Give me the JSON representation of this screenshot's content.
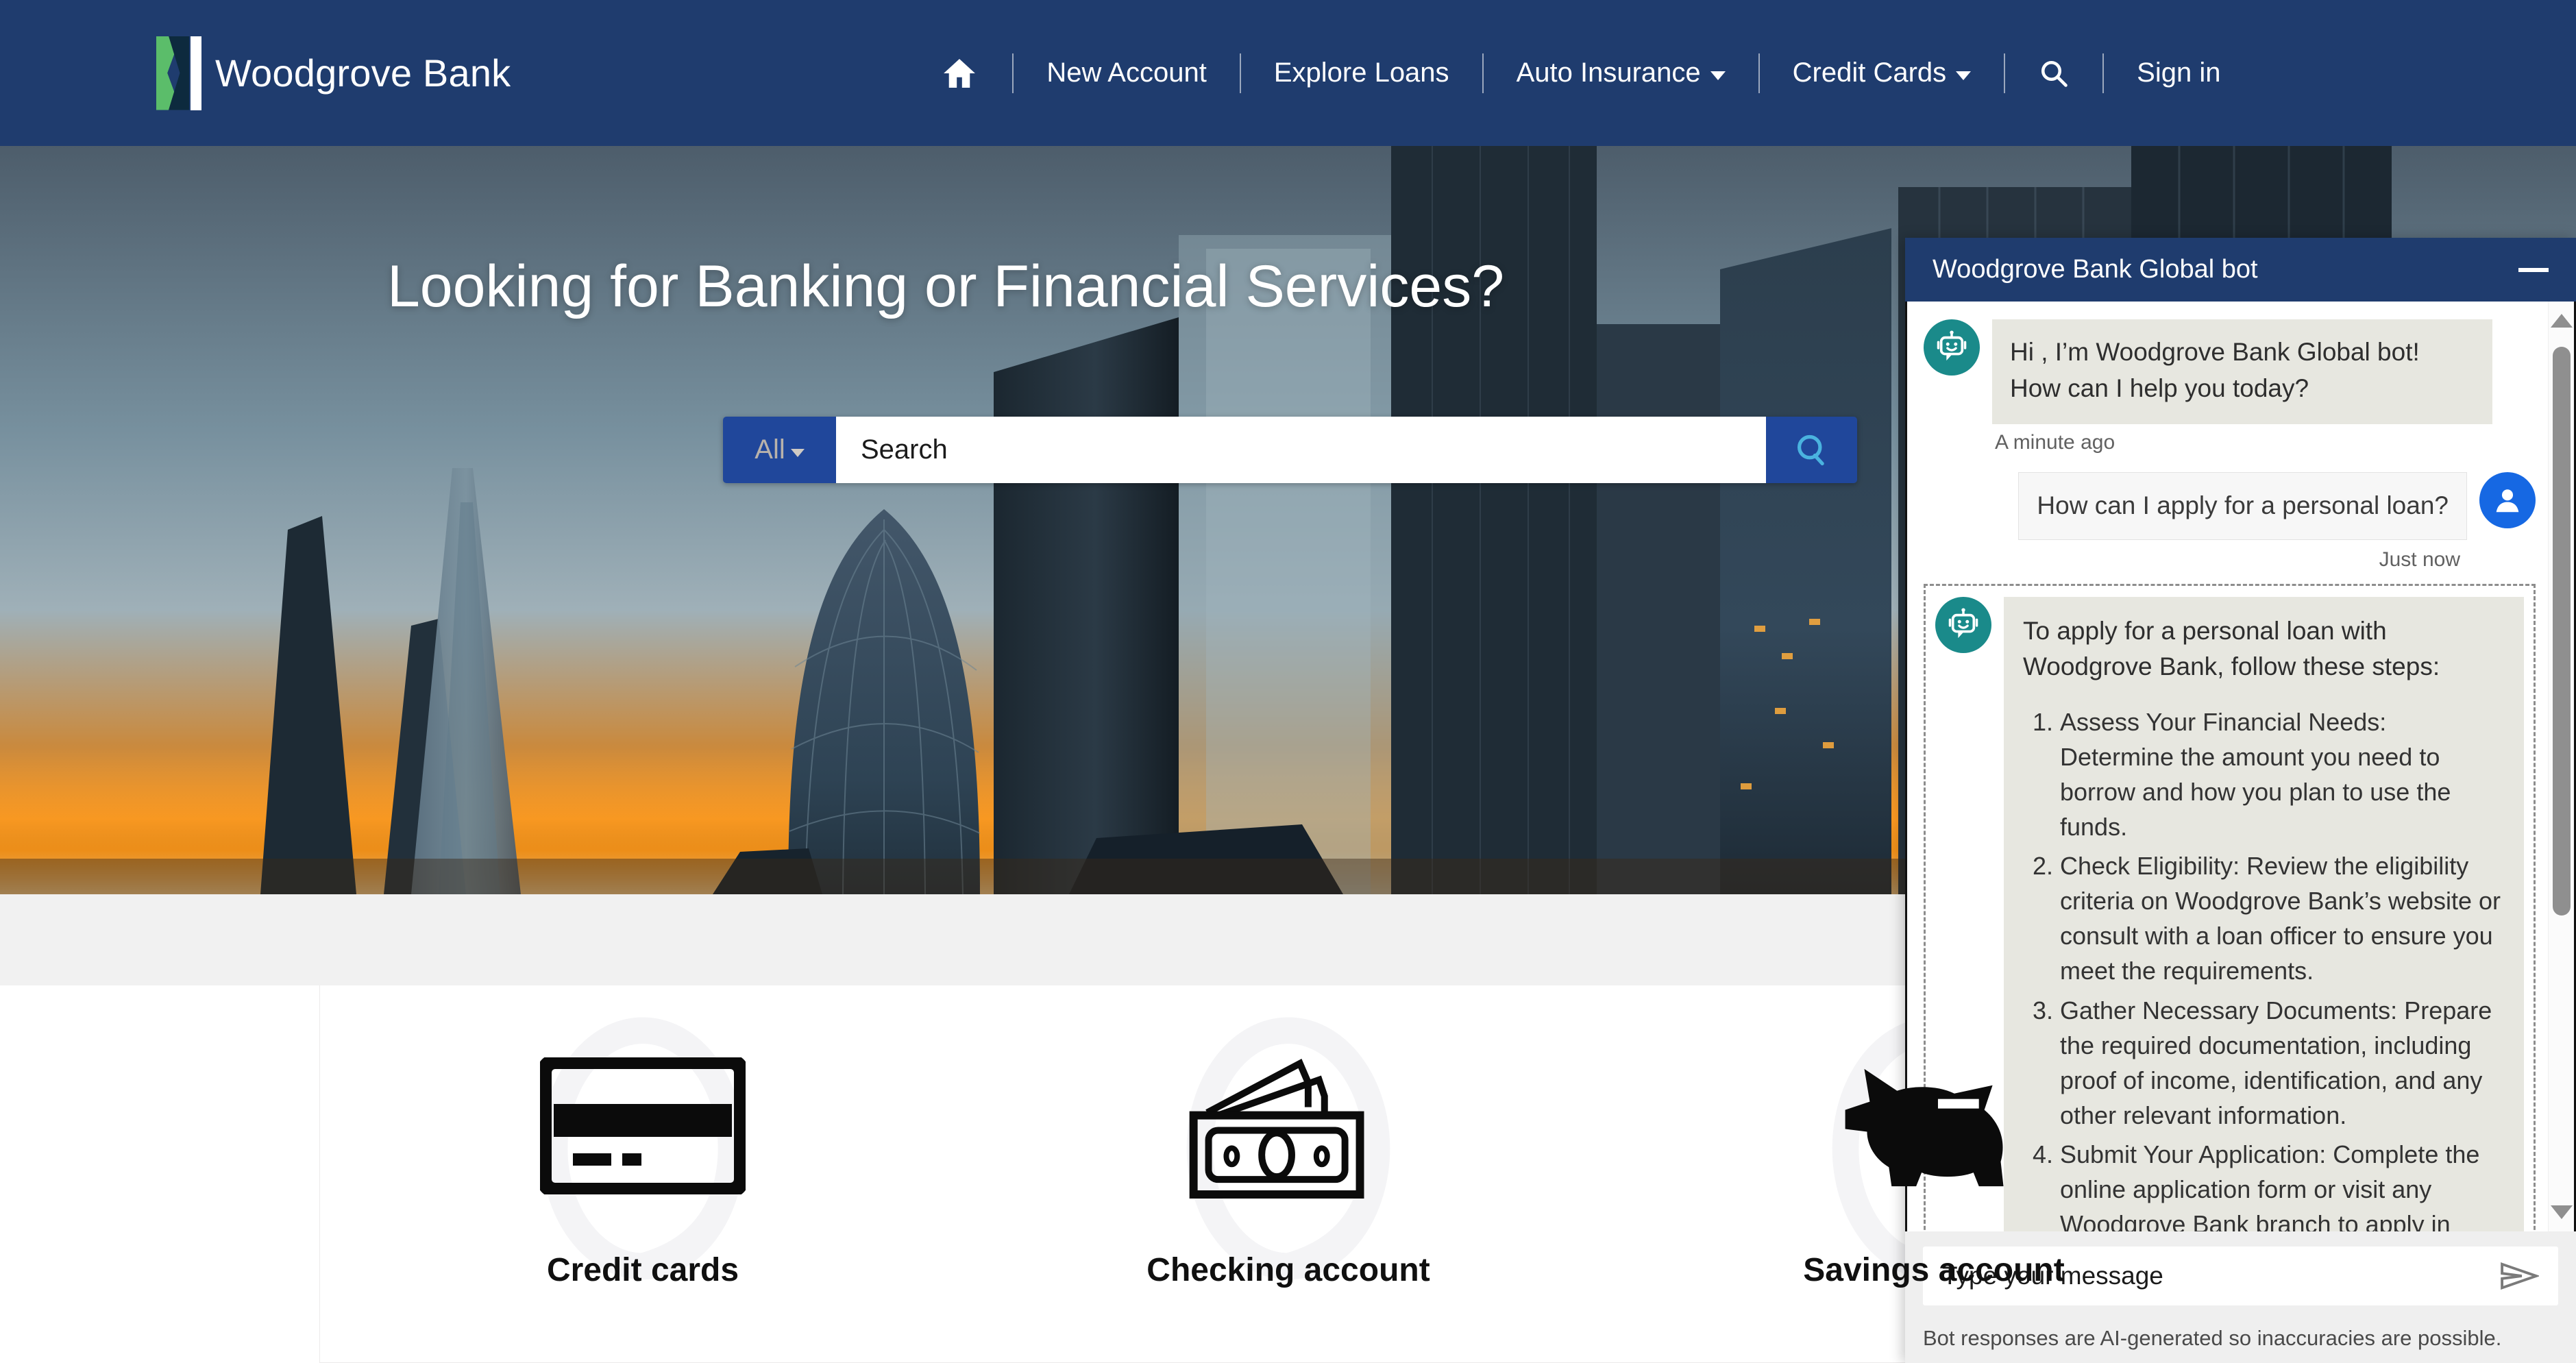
{
  "brand": {
    "name": "Woodgrove Bank",
    "logo_icon": "woodgrove-logo-icon"
  },
  "nav": {
    "home_icon": "home-icon",
    "search_icon": "search-icon",
    "items": [
      {
        "label": "New Account",
        "has_caret": false
      },
      {
        "label": "Explore Loans",
        "has_caret": false
      },
      {
        "label": "Auto Insurance",
        "has_caret": true
      },
      {
        "label": "Credit Cards",
        "has_caret": true
      }
    ],
    "signin": "Sign in"
  },
  "hero": {
    "title": "Looking for Banking or Financial Services?",
    "search": {
      "scope_label": "All",
      "placeholder": "Search",
      "value": "",
      "button_icon": "search-icon"
    }
  },
  "cards": [
    {
      "label": "Credit cards",
      "icon": "credit-card-icon"
    },
    {
      "label": "Checking account",
      "icon": "banknotes-icon"
    },
    {
      "label": "Savings account",
      "icon": "piggy-bank-icon"
    }
  ],
  "chat": {
    "title": "Woodgrove Bank Global bot",
    "minimize_icon": "minimize-icon",
    "messages": [
      {
        "from": "bot",
        "avatar_icon": "robot-avatar-icon",
        "text": "Hi , I’m Woodgrove Bank Global bot! How can I help you today?",
        "timestamp": "A minute ago"
      },
      {
        "from": "user",
        "avatar_icon": "user-avatar-icon",
        "text": "How can I apply for a personal loan?",
        "timestamp": "Just now"
      }
    ],
    "answer": {
      "from": "bot",
      "avatar_icon": "robot-avatar-icon",
      "intro": "To apply for a personal loan with Woodgrove Bank, follow these steps:",
      "steps": [
        "Assess Your Financial Needs: Determine the amount you need to borrow and how you plan to use the funds.",
        "Check Eligibility: Review the eligibility criteria on Woodgrove Bank’s website or consult with a loan officer to ensure you meet the requirements.",
        "Gather Necessary Documents: Prepare the required documentation, including proof of income, identification, and any other relevant information.",
        "Submit Your Application: Complete the online application form or visit any Woodgrove Bank branch to apply in"
      ]
    },
    "input": {
      "placeholder": "Type your message",
      "value": "",
      "send_icon": "send-icon"
    },
    "disclaimer": "Bot responses are AI-generated so inaccuracies are possible."
  },
  "colors": {
    "brand_navy": "#1f3c6e",
    "search_blue": "#20479b",
    "bot_avatar_teal": "#1a8a8a",
    "user_avatar_blue": "#1668e3",
    "bot_bubble": "#e7e7e0",
    "logo_green": "#5bbd6a"
  }
}
